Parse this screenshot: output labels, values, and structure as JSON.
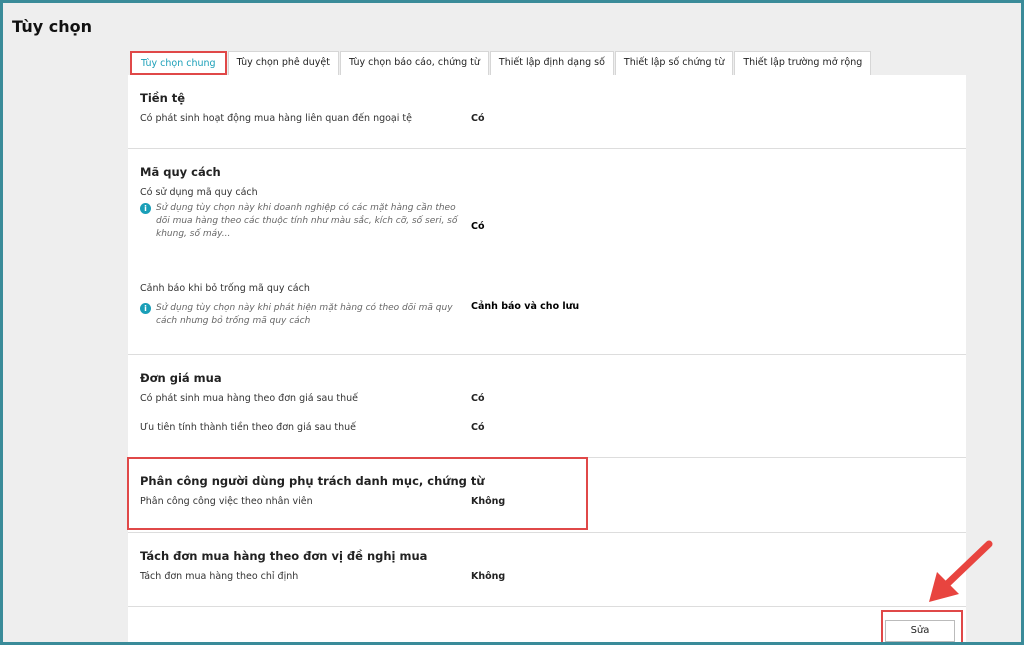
{
  "title": "Tùy chọn",
  "tabs": [
    "Tùy chọn chung",
    "Tùy chọn phê duyệt",
    "Tùy chọn báo cáo, chứng từ",
    "Thiết lập định dạng số",
    "Thiết lập số chứng từ",
    "Thiết lập trường mở rộng"
  ],
  "sections": [
    {
      "title": "Tiền tệ",
      "rows": [
        {
          "label": "Có phát sinh hoạt động mua hàng liên quan đến ngoại tệ",
          "value": "Có"
        }
      ]
    },
    {
      "title": "Mã quy cách",
      "rows": [
        {
          "label": "Có sử dụng mã quy cách",
          "note": "Sử dụng tùy chọn này khi doanh nghiệp có các mặt hàng cần theo dõi mua hàng theo các thuộc tính như màu sắc, kích cỡ, số seri, số khung, số máy...",
          "value": "Có"
        },
        {
          "label": "Cảnh báo khi bỏ trống mã quy cách",
          "note": "Sử dụng tùy chọn này khi phát hiện mặt hàng có theo dõi mã quy cách nhưng bỏ trống mã quy cách",
          "value": "Cảnh báo và cho lưu"
        }
      ]
    },
    {
      "title": "Đơn giá mua",
      "rows": [
        {
          "label": "Có phát sinh mua hàng theo đơn giá sau thuế",
          "value": "Có"
        },
        {
          "label": "Ưu tiên tính thành tiền theo đơn giá sau thuế",
          "value": "Có"
        }
      ]
    },
    {
      "title": "Phân công người dùng phụ trách danh mục, chứng từ",
      "rows": [
        {
          "label": "Phân công công việc theo nhân viên",
          "value": "Không"
        }
      ]
    },
    {
      "title": "Tách đơn mua hàng theo đơn vị đề nghị mua",
      "rows": [
        {
          "label": "Tách đơn mua hàng theo chỉ định",
          "value": "Không"
        }
      ]
    }
  ],
  "edit_button": "Sửa",
  "colors": {
    "accent": "#1a9fb8",
    "highlight": "#e04848",
    "arrow": "#e8443f"
  }
}
